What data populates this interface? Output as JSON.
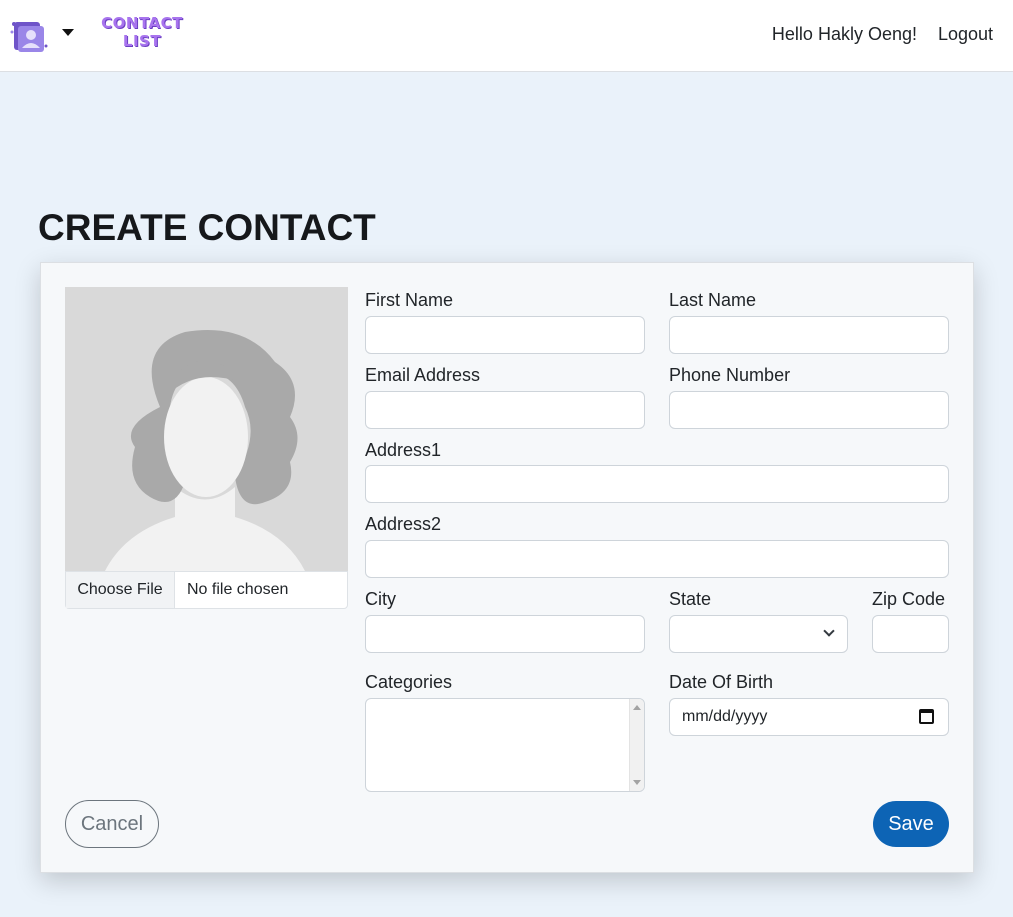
{
  "navbar": {
    "brand_text": "CONTACT LIST",
    "greeting": "Hello Hakly Oeng!",
    "logout_label": "Logout"
  },
  "page": {
    "title": "CREATE CONTACT"
  },
  "form": {
    "file_button_label": "Choose File",
    "file_status": "No file chosen",
    "first_name_label": "First Name",
    "last_name_label": "Last Name",
    "email_label": "Email Address",
    "phone_label": "Phone Number",
    "address1_label": "Address1",
    "address2_label": "Address2",
    "city_label": "City",
    "state_label": "State",
    "zip_label": "Zip Code",
    "categories_label": "Categories",
    "dob_label": "Date Of Birth",
    "dob_placeholder": "mm/dd/yyyy",
    "cancel_label": "Cancel",
    "save_label": "Save"
  },
  "icons": {
    "logo": "contact-list-logo-icon",
    "caret": "caret-down-icon",
    "avatar": "default-avatar-icon",
    "select": "chevron-down-icon",
    "calendar": "calendar-icon"
  },
  "colors": {
    "primary": "#0d64b5",
    "brand": "#a874ee",
    "background": "#eaf2fa"
  }
}
